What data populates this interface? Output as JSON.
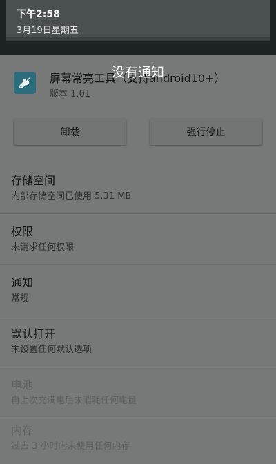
{
  "shade": {
    "time": "下午2:58",
    "date": "3月19日星期五",
    "empty_message": "没有通知"
  },
  "app": {
    "name": "屏幕常亮工具（支持android10+）",
    "version": "版本 1.01",
    "icon": "wrench-icon"
  },
  "buttons": {
    "uninstall": "卸载",
    "force_stop": "强行停止"
  },
  "sections": [
    {
      "title": "存储空间",
      "subtitle": "内部存储空间已使用 5.31 MB"
    },
    {
      "title": "权限",
      "subtitle": "未请求任何权限"
    },
    {
      "title": "通知",
      "subtitle": "常规"
    },
    {
      "title": "默认打开",
      "subtitle": "未设置任何默认选项"
    },
    {
      "title": "电池",
      "subtitle": "自上次充满电后未消耗任何电量"
    },
    {
      "title": "内存",
      "subtitle": "过去 3 小时内未使用任何内存"
    }
  ]
}
